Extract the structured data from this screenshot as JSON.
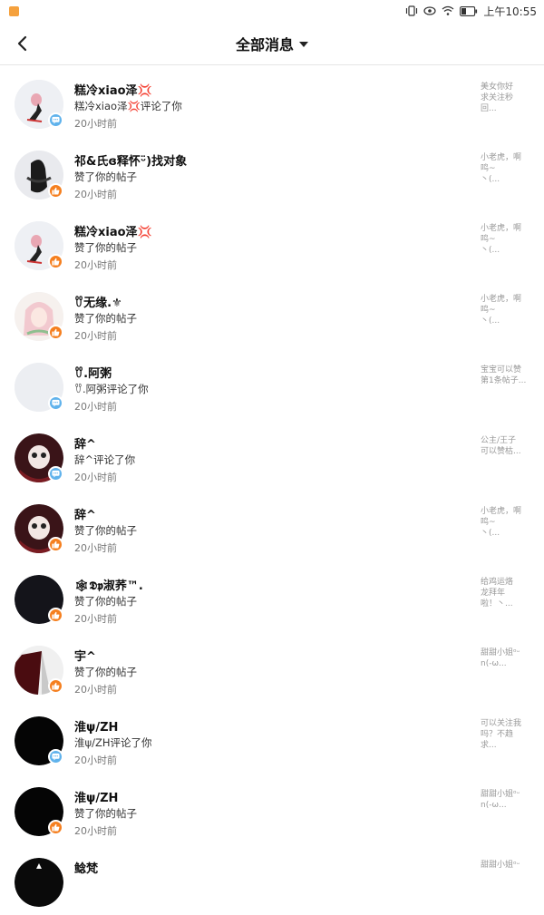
{
  "status_bar": {
    "time": "上午10:55",
    "icons": [
      "notification-app-icon",
      "vibrate-icon",
      "eye-icon",
      "wifi-icon",
      "battery-icon"
    ]
  },
  "header": {
    "title": "全部消息",
    "back_icon": "back-arrow-icon",
    "dropdown_icon": "caret-down-icon"
  },
  "colors": {
    "comment_badge": "#5fb2ec",
    "like_badge": "#f57f1f",
    "divider": "#e6e6e6"
  },
  "messages": [
    {
      "name": "糕冷xiao泽💢",
      "action": "糕冷xiao泽💢评论了你",
      "time": "20小时前",
      "badge": "comment",
      "preview": "美女你好\n求关注秒\n回..."
    },
    {
      "name": "祁&氏ɞ释怀ᵕ̈)找对象",
      "action": "赞了你的帖子",
      "time": "20小时前",
      "badge": "like",
      "preview": "小老虎，啊\n鸣~\n丶(..."
    },
    {
      "name": "糕冷xiao泽💢",
      "action": "赞了你的帖子",
      "time": "20小时前",
      "badge": "like",
      "preview": "小老虎，啊\n鸣~\n丶(..."
    },
    {
      "name": "ꀎ无缘.⚜",
      "action": "赞了你的帖子",
      "time": "20小时前",
      "badge": "like",
      "preview": "小老虎，啊\n鸣~\n丶(..."
    },
    {
      "name": "ꀎ.阿粥",
      "action": "ꀎ.阿粥评论了你",
      "time": "20小时前",
      "badge": "comment",
      "preview": "宝宝可以赞\n第1条帖子..."
    },
    {
      "name": "辞^",
      "action": "辞^评论了你",
      "time": "20小时前",
      "badge": "comment",
      "preview": "公主/王子\n可以赞枯..."
    },
    {
      "name": "辞^",
      "action": "赞了你的帖子",
      "time": "20小时前",
      "badge": "like",
      "preview": "小老虎，啊\n鸣~\n丶(..."
    },
    {
      "name": "🕸𝕯𝖕淑荞™.",
      "action": "赞了你的帖子",
      "time": "20小时前",
      "badge": "like",
      "preview": "给鸡运烙\n龙拜年\n啦！丶..."
    },
    {
      "name": "宇^",
      "action": "赞了你的帖子",
      "time": "20小时前",
      "badge": "like",
      "preview": "甜甜小姐ᵒᵕ\nn(-ω..."
    },
    {
      "name": "淮ψ/ZH",
      "action": "淮ψ/ZH评论了你",
      "time": "20小时前",
      "badge": "comment",
      "preview": "可以关注我\n吗？不趋\n求..."
    },
    {
      "name": "淮ψ/ZH",
      "action": "赞了你的帖子",
      "time": "20小时前",
      "badge": "like",
      "preview": "甜甜小姐ᵒᵕ\nn(-ω..."
    },
    {
      "name": "鲶梵",
      "action": "",
      "time": "",
      "badge": "",
      "preview": "甜甜小姐ᵒᵕ"
    }
  ]
}
